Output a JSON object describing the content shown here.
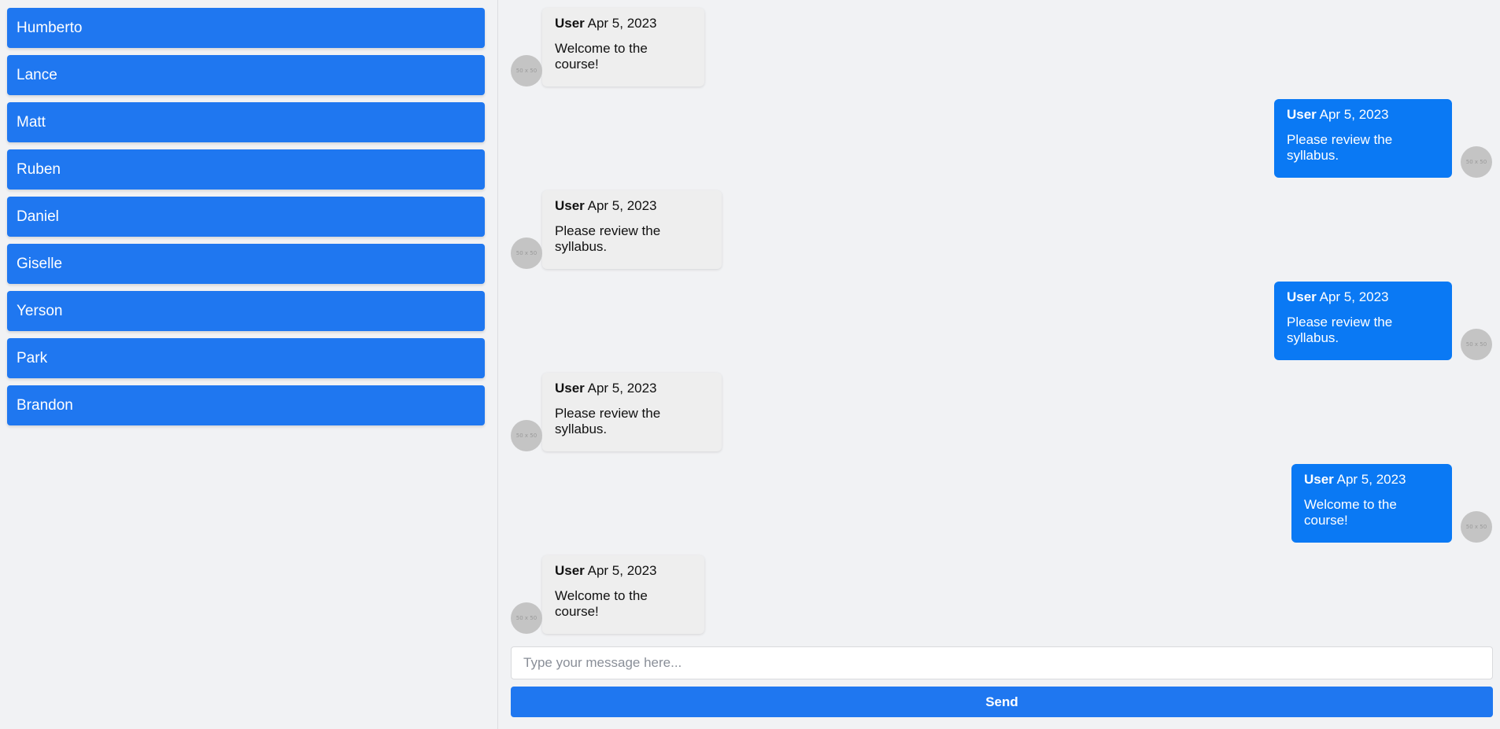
{
  "sidebar": {
    "contacts": [
      {
        "name": "Humberto"
      },
      {
        "name": "Lance"
      },
      {
        "name": "Matt"
      },
      {
        "name": "Ruben"
      },
      {
        "name": "Daniel"
      },
      {
        "name": "Giselle"
      },
      {
        "name": "Yerson"
      },
      {
        "name": "Park"
      },
      {
        "name": "Brandon"
      }
    ]
  },
  "messages": [
    {
      "direction": "in",
      "author": "User",
      "date": "Apr 5, 2023",
      "text": "Welcome to the course!",
      "avatar": "50 x 50"
    },
    {
      "direction": "out",
      "author": "User",
      "date": "Apr 5, 2023",
      "text": "Please review the syllabus.",
      "avatar": "50 x 50"
    },
    {
      "direction": "in",
      "author": "User",
      "date": "Apr 5, 2023",
      "text": "Please review the syllabus.",
      "avatar": "50 x 50"
    },
    {
      "direction": "out",
      "author": "User",
      "date": "Apr 5, 2023",
      "text": "Please review the syllabus.",
      "avatar": "50 x 50"
    },
    {
      "direction": "in",
      "author": "User",
      "date": "Apr 5, 2023",
      "text": "Please review the syllabus.",
      "avatar": "50 x 50"
    },
    {
      "direction": "out",
      "author": "User",
      "date": "Apr 5, 2023",
      "text": "Welcome to the course!",
      "avatar": "50 x 50"
    },
    {
      "direction": "in",
      "author": "User",
      "date": "Apr 5, 2023",
      "text": "Welcome to the course!",
      "avatar": "50 x 50"
    }
  ],
  "composer": {
    "placeholder": "Type your message here...",
    "value": "",
    "send_label": "Send"
  },
  "colors": {
    "accent": "#1f77f0",
    "outgoing_bubble": "#0a79f4",
    "incoming_bubble": "#eeeeee",
    "background": "#f1f2f4"
  }
}
